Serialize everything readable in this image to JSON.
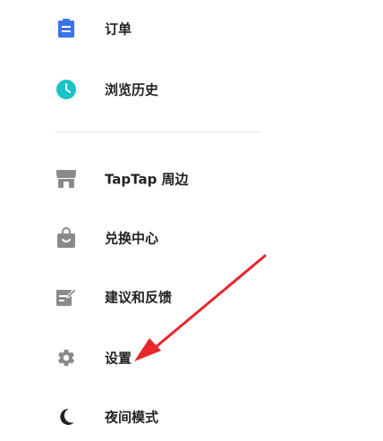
{
  "menu": {
    "items": [
      {
        "id": "orders",
        "label": "订单",
        "icon": "clipboard-icon"
      },
      {
        "id": "history",
        "label": "浏览历史",
        "icon": "clock-icon"
      },
      {
        "id": "merch",
        "label": "TapTap 周边",
        "icon": "store-icon"
      },
      {
        "id": "redeem",
        "label": "兑换中心",
        "icon": "bag-icon"
      },
      {
        "id": "feedback",
        "label": "建议和反馈",
        "icon": "edit-note-icon"
      },
      {
        "id": "settings",
        "label": "设置",
        "icon": "gear-icon"
      },
      {
        "id": "night",
        "label": "夜间模式",
        "icon": "moon-icon"
      }
    ]
  },
  "colors": {
    "blue": "#3b73e8",
    "teal": "#1dc1c6",
    "gray_icon": "#8a8a8a",
    "text": "#222222",
    "arrow": "#e8262b",
    "divider": "#e6e6e6"
  },
  "annotation": {
    "type": "red-arrow",
    "points_to": "settings"
  }
}
